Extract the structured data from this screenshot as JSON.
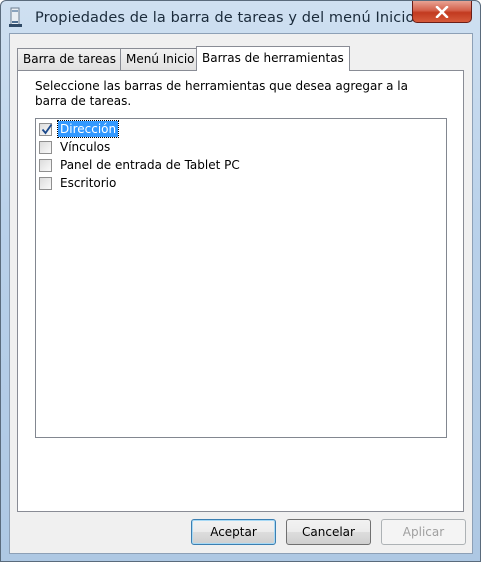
{
  "window": {
    "title": "Propiedades de la barra de tareas y del menú Inicio"
  },
  "tabs": [
    {
      "label": "Barra de tareas",
      "active": false
    },
    {
      "label": "Menú Inicio",
      "active": false
    },
    {
      "label": "Barras de herramientas",
      "active": true
    }
  ],
  "panel": {
    "description": "Seleccione las barras de herramientas que desea agregar a la barra de tareas.",
    "toolbars": [
      {
        "label": "Dirección",
        "checked": true,
        "selected": true
      },
      {
        "label": "Vínculos",
        "checked": false,
        "selected": false
      },
      {
        "label": "Panel de entrada de Tablet PC",
        "checked": false,
        "selected": false
      },
      {
        "label": "Escritorio",
        "checked": false,
        "selected": false
      }
    ]
  },
  "buttons": {
    "ok": "Aceptar",
    "cancel": "Cancelar",
    "apply": "Aplicar"
  },
  "colors": {
    "selection": "#3399ff",
    "close_button": "#c8432a"
  }
}
